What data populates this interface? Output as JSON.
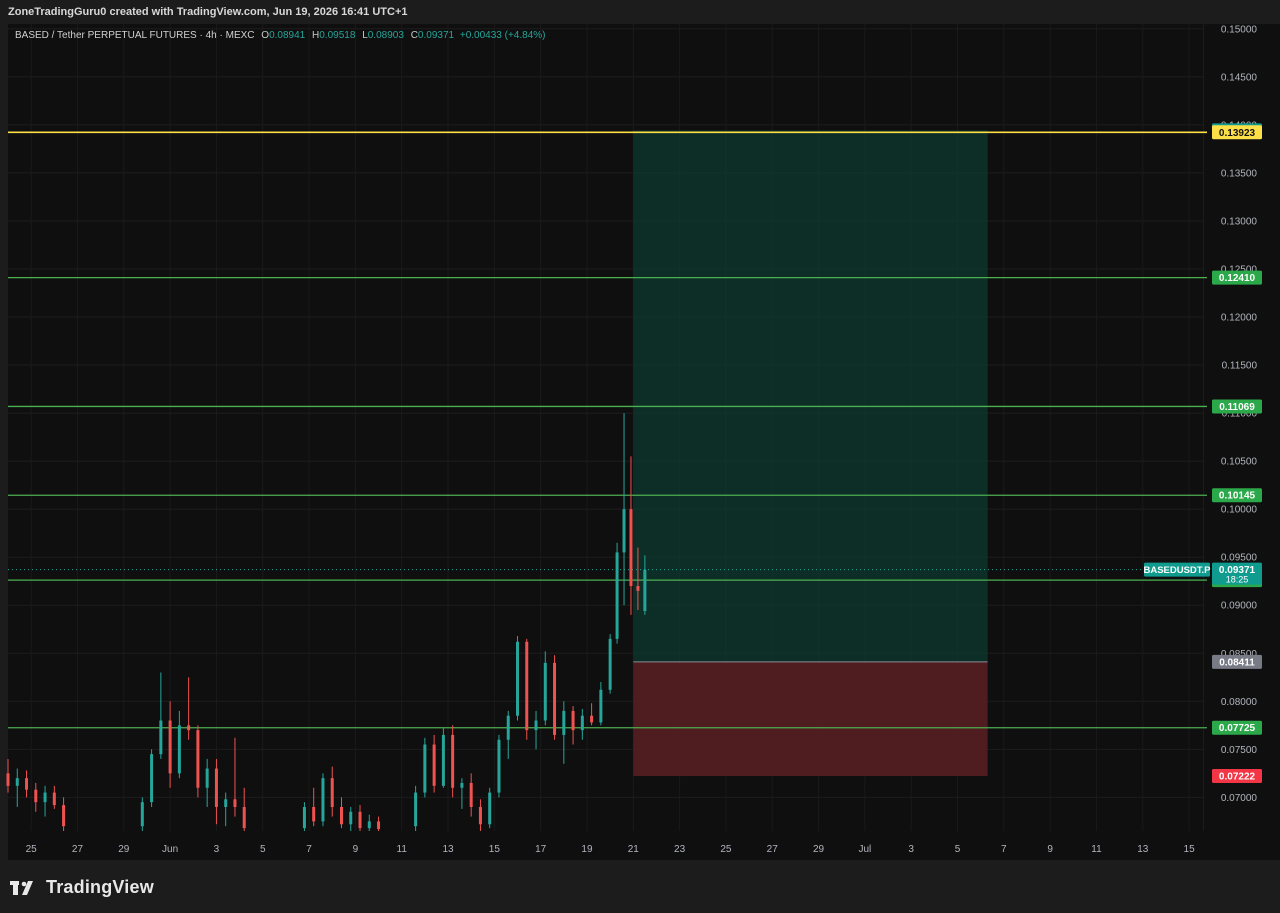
{
  "credit": "ZoneTradingGuru0 created with TradingView.com, Jun 19, 2026 16:41 UTC+1",
  "brand": {
    "name": "TradingView"
  },
  "legend": {
    "symbol": "BASED / Tether PERPETUAL FUTURES · 4h · MEXC",
    "open_key": "O",
    "open": "0.08941",
    "high_key": "H",
    "high": "0.09518",
    "low_key": "L",
    "low": "0.08903",
    "close_key": "C",
    "close": "0.09371",
    "change": "+0.00433 (+4.84%)"
  },
  "colors": {
    "background": "#0f0f0f",
    "up": "#26a69a",
    "down": "#ef5350",
    "level_line": "#4caf50",
    "level_label": "#2ba84a",
    "entry_line": "#fde047",
    "target_zone": "#0d3a30",
    "stop_zone": "#5a1f22",
    "price_tag": "#0f9b8e",
    "stop_tag": "#f23645",
    "entry_tag": "#787b86"
  },
  "chart_data": {
    "type": "candlestick",
    "symbol": "BASEDUSDT.P",
    "timeframe": "4h",
    "ylim": [
      0.0665,
      0.1505
    ],
    "y_ticks": [
      "0.07000",
      "0.07500",
      "0.08000",
      "0.08500",
      "0.09000",
      "0.09500",
      "0.10000",
      "0.10500",
      "0.11000",
      "0.11500",
      "0.12000",
      "0.12500",
      "0.13000",
      "0.13500",
      "0.14000",
      "0.14500",
      "0.15000"
    ],
    "x_ticks": [
      {
        "label": "25",
        "day": 25
      },
      {
        "label": "27",
        "day": 27
      },
      {
        "label": "29",
        "day": 29
      },
      {
        "label": "Jun",
        "day": 31
      },
      {
        "label": "3",
        "day": 33
      },
      {
        "label": "5",
        "day": 35
      },
      {
        "label": "7",
        "day": 37
      },
      {
        "label": "9",
        "day": 39
      },
      {
        "label": "11",
        "day": 41
      },
      {
        "label": "13",
        "day": 43
      },
      {
        "label": "15",
        "day": 45
      },
      {
        "label": "17",
        "day": 47
      },
      {
        "label": "19",
        "day": 49
      },
      {
        "label": "21",
        "day": 51
      },
      {
        "label": "23",
        "day": 53
      },
      {
        "label": "25",
        "day": 55
      },
      {
        "label": "27",
        "day": 57
      },
      {
        "label": "29",
        "day": 59
      },
      {
        "label": "Jul",
        "day": 61
      },
      {
        "label": "3",
        "day": 63
      },
      {
        "label": "5",
        "day": 65
      },
      {
        "label": "7",
        "day": 67
      },
      {
        "label": "9",
        "day": 69
      },
      {
        "label": "11",
        "day": 71
      },
      {
        "label": "13",
        "day": 73
      },
      {
        "label": "15",
        "day": 75
      }
    ],
    "x_range": [
      24.0,
      75.6
    ],
    "horizontal_levels": [
      {
        "price": 0.13923,
        "label": "0.13923",
        "style": "entry"
      },
      {
        "price": 0.1241,
        "label": "0.12410",
        "style": "level"
      },
      {
        "price": 0.11069,
        "label": "0.11069",
        "style": "level"
      },
      {
        "price": 0.10145,
        "label": "0.10145",
        "style": "level"
      },
      {
        "price": 0.09261,
        "label": "0.09261",
        "style": "level"
      },
      {
        "price": 0.07725,
        "label": "0.07725",
        "style": "level"
      }
    ],
    "position": {
      "start_day": 51.0,
      "end_day": 66.3,
      "target": 0.13943,
      "target_label": "0.13943",
      "entry": 0.08411,
      "entry_label": "0.08411",
      "stop": 0.07222,
      "stop_label": "0.07222"
    },
    "last_price": {
      "value": 0.09371,
      "label": "0.09371",
      "symbol": "BASEDUSDT.P",
      "countdown": "18:25"
    },
    "candles": [
      {
        "day": 24.0,
        "o": 0.0725,
        "h": 0.074,
        "l": 0.0705,
        "c": 0.0712
      },
      {
        "day": 24.4,
        "o": 0.0712,
        "h": 0.073,
        "l": 0.069,
        "c": 0.072
      },
      {
        "day": 24.8,
        "o": 0.072,
        "h": 0.0728,
        "l": 0.07,
        "c": 0.0708
      },
      {
        "day": 25.2,
        "o": 0.0708,
        "h": 0.0715,
        "l": 0.0685,
        "c": 0.0695
      },
      {
        "day": 25.6,
        "o": 0.0695,
        "h": 0.0712,
        "l": 0.068,
        "c": 0.0705
      },
      {
        "day": 26.0,
        "o": 0.0705,
        "h": 0.0712,
        "l": 0.0688,
        "c": 0.0692
      },
      {
        "day": 26.4,
        "o": 0.0692,
        "h": 0.07,
        "l": 0.0665,
        "c": 0.067
      },
      {
        "day": 29.8,
        "o": 0.067,
        "h": 0.07,
        "l": 0.0665,
        "c": 0.0695
      },
      {
        "day": 30.2,
        "o": 0.0695,
        "h": 0.075,
        "l": 0.069,
        "c": 0.0745
      },
      {
        "day": 30.6,
        "o": 0.0745,
        "h": 0.083,
        "l": 0.074,
        "c": 0.078
      },
      {
        "day": 31.0,
        "o": 0.078,
        "h": 0.08,
        "l": 0.071,
        "c": 0.0725
      },
      {
        "day": 31.4,
        "o": 0.0725,
        "h": 0.079,
        "l": 0.072,
        "c": 0.0775
      },
      {
        "day": 31.8,
        "o": 0.0775,
        "h": 0.0825,
        "l": 0.076,
        "c": 0.077
      },
      {
        "day": 32.2,
        "o": 0.077,
        "h": 0.0775,
        "l": 0.07,
        "c": 0.071
      },
      {
        "day": 32.6,
        "o": 0.071,
        "h": 0.074,
        "l": 0.069,
        "c": 0.073
      },
      {
        "day": 33.0,
        "o": 0.073,
        "h": 0.074,
        "l": 0.0672,
        "c": 0.069
      },
      {
        "day": 33.4,
        "o": 0.069,
        "h": 0.0705,
        "l": 0.067,
        "c": 0.0698
      },
      {
        "day": 33.8,
        "o": 0.0698,
        "h": 0.0762,
        "l": 0.068,
        "c": 0.069
      },
      {
        "day": 34.2,
        "o": 0.069,
        "h": 0.071,
        "l": 0.0665,
        "c": 0.0668
      },
      {
        "day": 36.8,
        "o": 0.0668,
        "h": 0.0695,
        "l": 0.0665,
        "c": 0.069
      },
      {
        "day": 37.2,
        "o": 0.069,
        "h": 0.071,
        "l": 0.067,
        "c": 0.0675
      },
      {
        "day": 37.6,
        "o": 0.0675,
        "h": 0.0725,
        "l": 0.067,
        "c": 0.072
      },
      {
        "day": 38.0,
        "o": 0.072,
        "h": 0.0732,
        "l": 0.068,
        "c": 0.069
      },
      {
        "day": 38.4,
        "o": 0.069,
        "h": 0.07,
        "l": 0.0668,
        "c": 0.0672
      },
      {
        "day": 38.8,
        "o": 0.0672,
        "h": 0.069,
        "l": 0.0665,
        "c": 0.0685
      },
      {
        "day": 39.2,
        "o": 0.0685,
        "h": 0.0692,
        "l": 0.0665,
        "c": 0.0668
      },
      {
        "day": 39.6,
        "o": 0.0668,
        "h": 0.0682,
        "l": 0.0665,
        "c": 0.0675
      },
      {
        "day": 40.0,
        "o": 0.0675,
        "h": 0.068,
        "l": 0.0665,
        "c": 0.0667
      },
      {
        "day": 41.6,
        "o": 0.067,
        "h": 0.0712,
        "l": 0.0665,
        "c": 0.0705
      },
      {
        "day": 42.0,
        "o": 0.0705,
        "h": 0.0762,
        "l": 0.07,
        "c": 0.0755
      },
      {
        "day": 42.4,
        "o": 0.0755,
        "h": 0.0765,
        "l": 0.0705,
        "c": 0.0712
      },
      {
        "day": 42.8,
        "o": 0.0712,
        "h": 0.0772,
        "l": 0.071,
        "c": 0.0765
      },
      {
        "day": 43.2,
        "o": 0.0765,
        "h": 0.0775,
        "l": 0.07,
        "c": 0.071
      },
      {
        "day": 43.6,
        "o": 0.071,
        "h": 0.072,
        "l": 0.0688,
        "c": 0.0715
      },
      {
        "day": 44.0,
        "o": 0.0715,
        "h": 0.0725,
        "l": 0.068,
        "c": 0.069
      },
      {
        "day": 44.4,
        "o": 0.069,
        "h": 0.0698,
        "l": 0.0665,
        "c": 0.0672
      },
      {
        "day": 44.8,
        "o": 0.0672,
        "h": 0.071,
        "l": 0.0668,
        "c": 0.0705
      },
      {
        "day": 45.2,
        "o": 0.0705,
        "h": 0.0765,
        "l": 0.07,
        "c": 0.076
      },
      {
        "day": 45.6,
        "o": 0.076,
        "h": 0.079,
        "l": 0.074,
        "c": 0.0785
      },
      {
        "day": 46.0,
        "o": 0.0785,
        "h": 0.0868,
        "l": 0.078,
        "c": 0.0862
      },
      {
        "day": 46.4,
        "o": 0.0862,
        "h": 0.0865,
        "l": 0.076,
        "c": 0.077
      },
      {
        "day": 46.8,
        "o": 0.077,
        "h": 0.079,
        "l": 0.075,
        "c": 0.078
      },
      {
        "day": 47.2,
        "o": 0.078,
        "h": 0.0852,
        "l": 0.0775,
        "c": 0.084
      },
      {
        "day": 47.6,
        "o": 0.084,
        "h": 0.0848,
        "l": 0.076,
        "c": 0.0765
      },
      {
        "day": 48.0,
        "o": 0.0765,
        "h": 0.08,
        "l": 0.0735,
        "c": 0.079
      },
      {
        "day": 48.4,
        "o": 0.079,
        "h": 0.0795,
        "l": 0.0755,
        "c": 0.077
      },
      {
        "day": 48.8,
        "o": 0.077,
        "h": 0.0792,
        "l": 0.076,
        "c": 0.0785
      },
      {
        "day": 49.2,
        "o": 0.0785,
        "h": 0.0798,
        "l": 0.0775,
        "c": 0.0778
      },
      {
        "day": 49.6,
        "o": 0.0778,
        "h": 0.082,
        "l": 0.0775,
        "c": 0.0812
      },
      {
        "day": 50.0,
        "o": 0.0812,
        "h": 0.087,
        "l": 0.0808,
        "c": 0.0865
      },
      {
        "day": 50.3,
        "o": 0.0865,
        "h": 0.0965,
        "l": 0.086,
        "c": 0.0955
      },
      {
        "day": 50.6,
        "o": 0.0955,
        "h": 0.11,
        "l": 0.09,
        "c": 0.1
      },
      {
        "day": 50.9,
        "o": 0.1,
        "h": 0.1055,
        "l": 0.089,
        "c": 0.092
      },
      {
        "day": 51.2,
        "o": 0.092,
        "h": 0.096,
        "l": 0.0895,
        "c": 0.0915
      },
      {
        "day": 51.5,
        "o": 0.0894,
        "h": 0.0952,
        "l": 0.089,
        "c": 0.0937
      }
    ]
  }
}
